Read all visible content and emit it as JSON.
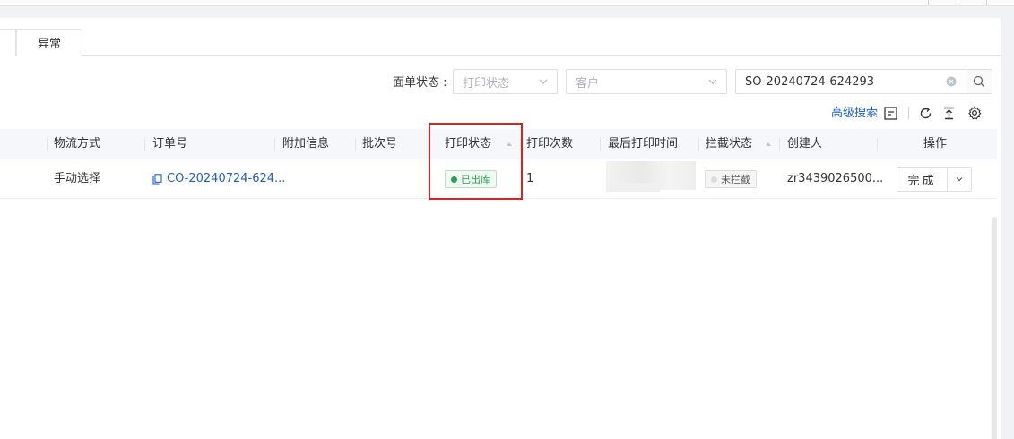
{
  "tabs": [
    {
      "label": "异常"
    }
  ],
  "filters": {
    "label": "面单状态 :",
    "print_status_placeholder": "打印状态",
    "customer_placeholder": "客户",
    "search_value": "SO-20240724-624293"
  },
  "toolbar": {
    "advanced_search": "高级搜索",
    "icons": [
      "expand-icon",
      "refresh-icon",
      "export-icon",
      "settings-icon"
    ]
  },
  "table": {
    "columns": [
      "物流方式",
      "订单号",
      "附加信息",
      "批次号",
      "打印状态",
      "打印次数",
      "最后打印时间",
      "拦截状态",
      "创建人",
      "操作"
    ],
    "rows": [
      {
        "logistics": "手动选择",
        "order_no": "CO-20240724-624...",
        "extra_info": "",
        "batch_no": "",
        "print_status": "已出库",
        "print_count": "1",
        "last_print_time": "",
        "intercept_status": "未拦截",
        "creator": "zr3439026500...",
        "action": "完成"
      }
    ]
  },
  "colors": {
    "accent": "#1f5fbf",
    "status_green": "#2e9d57",
    "highlight": "#e02020"
  }
}
